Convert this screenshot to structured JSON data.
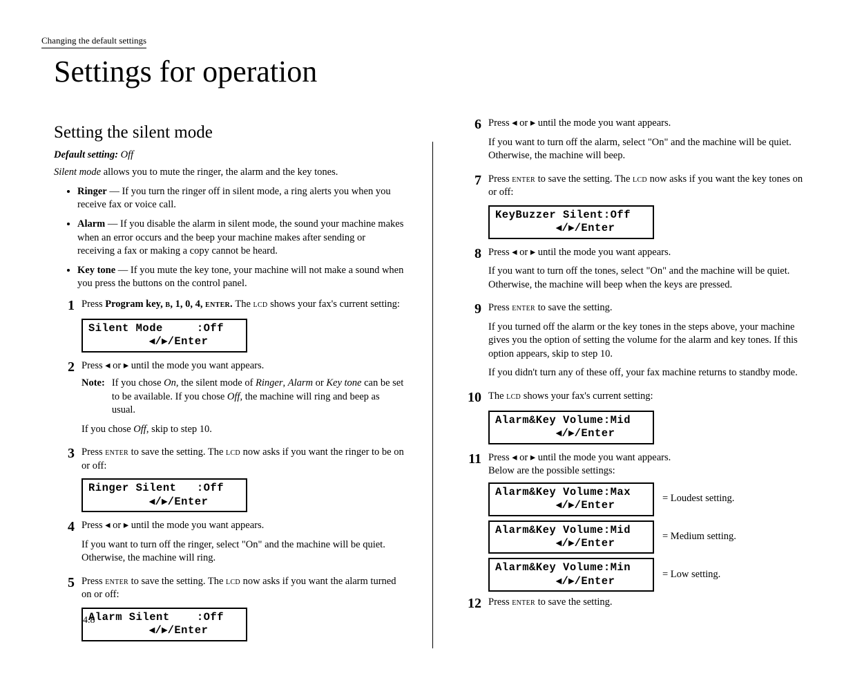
{
  "breadcrumb": "Changing the default settings",
  "title": "Settings for operation",
  "section_title": "Setting the silent mode",
  "default_label": "Default setting:",
  "default_value": "Off",
  "intro_em": "Silent mode",
  "intro_rest": " allows you to mute the ringer, the alarm and the key tones.",
  "defs": {
    "ringer": {
      "name": "Ringer",
      "text": " — If you turn the ringer off in silent mode, a ring alerts you when you receive fax or voice call."
    },
    "alarm": {
      "name": "Alarm",
      "text": " — If you disable the alarm in silent mode, the sound your machine makes when an error occurs and the beep your machine makes after sending or receiving a fax or making a copy cannot be heard."
    },
    "keytone": {
      "name": "Key tone",
      "text": " — If you mute the key tone, your machine will not make a sound when you press the buttons on the control panel."
    }
  },
  "steps": {
    "s1a": "Press ",
    "s1b": "Program key, ",
    "s1c": "b",
    "s1d": ", 1, 0, 4, ",
    "s1e": "enter.",
    "s1f": " The ",
    "s1g": "lcd",
    "s1h": " shows your fax's current setting:",
    "lcd1": "Silent Mode     :Off\n         ◂/▸/Enter",
    "s2": "Press ◂ or ▸ until the mode you want appears.",
    "note_label": "Note:",
    "note_a": "If you chose ",
    "note_on": "On",
    "note_b": ", the silent mode of ",
    "note_ringer": "Ringer",
    "note_c": ", ",
    "note_alarm": "Alarm",
    "note_d": " or ",
    "note_keytone": "Key tone",
    "note_e": " can be set to be available.  If you chose ",
    "note_off": "Off",
    "note_f": ", the machine will ring and beep as usual.",
    "s2_skip_a": "If you chose ",
    "s2_skip_off": "Off",
    "s2_skip_b": ", skip to step 10.",
    "s3a": "Press ",
    "s3b": "enter",
    "s3c": " to save the setting. The ",
    "s3d": "lcd",
    "s3e": " now asks if you want the ringer to be on or off:",
    "lcd3": "Ringer Silent   :Off\n         ◂/▸/Enter",
    "s4": "Press ◂ or ▸ until the mode you want appears.",
    "s4sub": "If you want to turn off the ringer, select \"On\" and the machine will be quiet. Otherwise, the machine will ring.",
    "s5a": "Press ",
    "s5b": "enter",
    "s5c": " to save the setting. The ",
    "s5d": "lcd",
    "s5e": " now asks if you want the alarm turned on or off:",
    "lcd5": "Alarm Silent    :Off\n         ◂/▸/Enter",
    "s6": "Press ◂ or ▸ until the mode you want appears.",
    "s6sub": "If you want to turn off the alarm, select \"On\" and the machine will be quiet. Otherwise, the machine will beep.",
    "s7a": "Press ",
    "s7b": "enter",
    "s7c": " to save the setting. The ",
    "s7d": "lcd",
    "s7e": " now asks if you want the key tones on or off:",
    "lcd7": "KeyBuzzer Silent:Off\n         ◂/▸/Enter",
    "s8": "Press ◂ or ▸ until the mode you want appears.",
    "s8sub": "If you want to turn off the tones, select \"On\" and the machine will be quiet. Otherwise, the machine will beep when the keys are pressed.",
    "s9a": "Press ",
    "s9b": "enter",
    "s9c": " to save the setting.",
    "s9sub1": "If you turned off the alarm or the key tones in the steps above, your machine gives you the option of setting the volume for the alarm and key tones. If this option appears, skip to step 10.",
    "s9sub2": "If you didn't turn any of these off, your fax machine returns to standby mode.",
    "s10a": "The ",
    "s10b": "lcd",
    "s10c": " shows your fax's current setting:",
    "lcd10": "Alarm&Key Volume:Mid\n         ◂/▸/Enter",
    "s11a": "Press ◂ or ▸ until the mode you want appears.",
    "s11b": "Below are the possible settings:",
    "vol": {
      "max": {
        "lcd": "Alarm&Key Volume:Max\n         ◂/▸/Enter",
        "caption": "= Loudest setting."
      },
      "mid": {
        "lcd": "Alarm&Key Volume:Mid\n         ◂/▸/Enter",
        "caption": "= Medium setting."
      },
      "min": {
        "lcd": "Alarm&Key Volume:Min\n         ◂/▸/Enter",
        "caption": "= Low setting."
      }
    },
    "s12a": "Press ",
    "s12b": "enter",
    "s12c": " to save the setting."
  },
  "pagenum": "4.8"
}
